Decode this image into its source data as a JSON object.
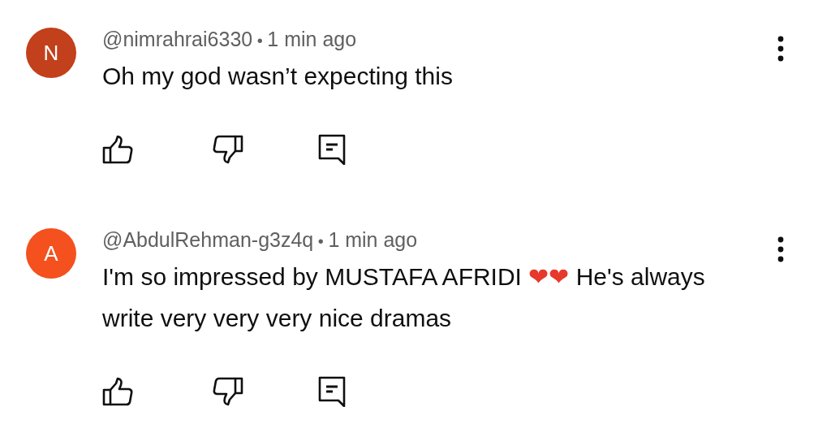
{
  "comments": [
    {
      "avatar": {
        "letter": "N",
        "color": "#c2401c"
      },
      "author": "@nimrahrai6330",
      "separator": "•",
      "time": "1 min ago",
      "text": [
        {
          "kind": "text",
          "text": "Oh my god wasn’t expecting this"
        }
      ]
    },
    {
      "avatar": {
        "letter": "A",
        "color": "#f4511e"
      },
      "author": "@AbdulRehman-g3z4q",
      "separator": "•",
      "time": "1 min ago",
      "text": [
        {
          "kind": "text",
          "text": "I'm so impressed by MUSTAFA AFRIDI "
        },
        {
          "kind": "emoji",
          "text": "❤❤"
        },
        {
          "kind": "text",
          "text": " He's always write very very very nice dramas"
        }
      ]
    }
  ]
}
